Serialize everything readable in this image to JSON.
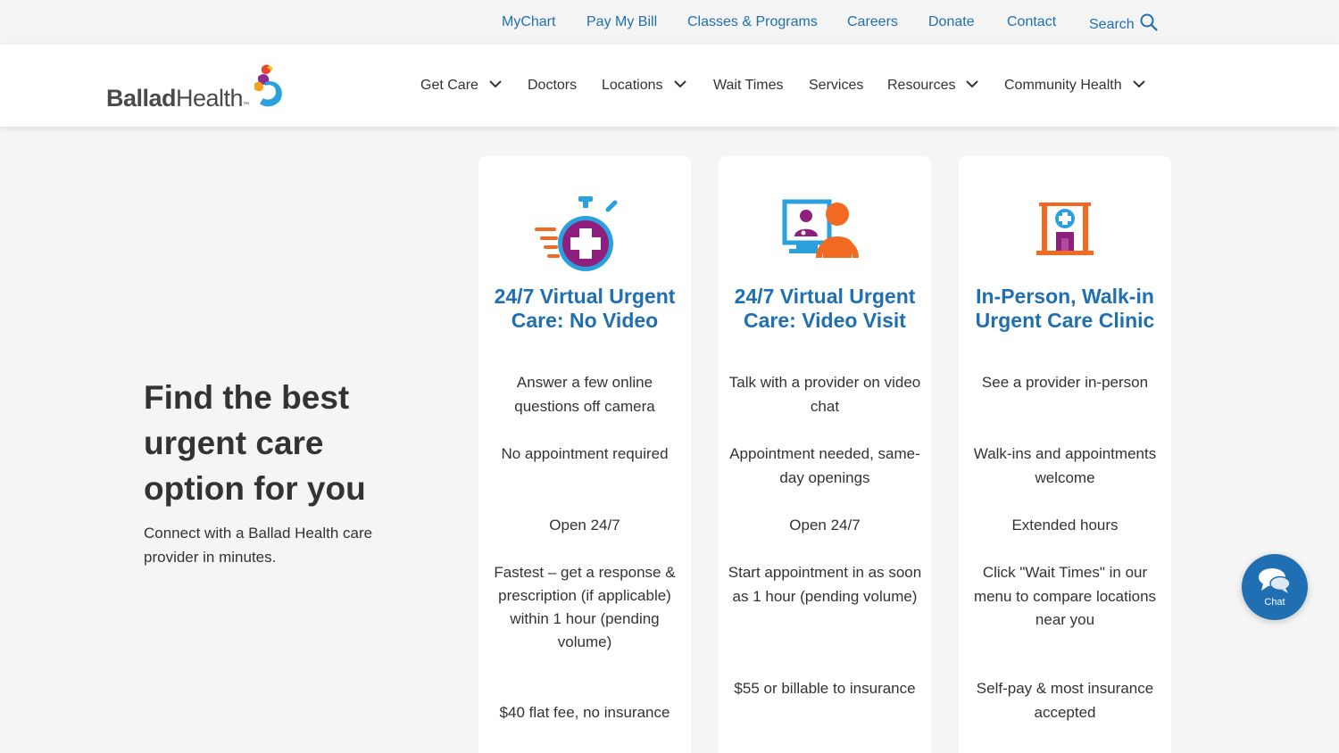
{
  "utility_nav": {
    "mychart": "MyChart",
    "pay_bill": "Pay My Bill",
    "classes": "Classes & Programs",
    "careers": "Careers",
    "donate": "Donate",
    "contact": "Contact",
    "search": "Search",
    "search_icon": "search-icon"
  },
  "logo": {
    "bold": "Ballad",
    "regular": "Health",
    "tm": "™"
  },
  "main_nav": {
    "get_care": "Get Care",
    "doctors": "Doctors",
    "locations": "Locations",
    "wait_times": "Wait Times",
    "services": "Services",
    "resources": "Resources",
    "community_health": "Community Health"
  },
  "hero": {
    "title": "Find the best urgent care option for you",
    "subtitle": "Connect with a Ballad Health care provider in minutes."
  },
  "cards": [
    {
      "icon": "stopwatch-medical-cross-icon",
      "title": "24/7 Virtual Urgent Care: No Video",
      "features": [
        "Answer a few online questions off camera",
        "No appointment required",
        "Open 24/7",
        "Fastest – get a response & prescription (if applicable) within 1 hour (pending volume)",
        "$40 flat fee, no insurance"
      ]
    },
    {
      "icon": "video-visit-icon",
      "title": "24/7 Virtual Urgent Care: Video Visit",
      "features": [
        "Talk with a provider on video chat",
        "Appointment needed, same-day openings",
        "Open 24/7",
        "Start appointment in as soon as 1 hour (pending volume)",
        "$55 or billable to insurance"
      ]
    },
    {
      "icon": "clinic-building-icon",
      "title": "In-Person, Walk-in Urgent Care Clinic",
      "features": [
        "See a provider in-person",
        "Walk-ins and appointments welcome",
        "Extended hours",
        "Click \"Wait Times\" in our menu to compare locations near you",
        "Self-pay & most insurance accepted"
      ]
    }
  ],
  "chat": {
    "label": "Chat",
    "icon": "chat-bubble-icon"
  },
  "colors": {
    "brand_blue": "#1f6fb2",
    "text_dark": "#333333",
    "background": "#f5f5f5"
  }
}
